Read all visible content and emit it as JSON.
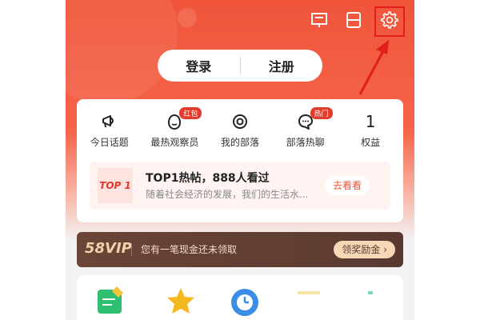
{
  "header": {
    "icons": [
      "scan-icon",
      "qr-code-icon",
      "settings-icon"
    ]
  },
  "auth": {
    "login": "登录",
    "register": "注册"
  },
  "menu": [
    {
      "label": "今日话题",
      "icon": "megaphone-icon",
      "badge": ""
    },
    {
      "label": "最热观察员",
      "icon": "face-icon",
      "badge": "红包"
    },
    {
      "label": "我的部落",
      "icon": "target-icon",
      "badge": ""
    },
    {
      "label": "部落热聊",
      "icon": "chat-icon",
      "badge": "热门"
    },
    {
      "label": "权益",
      "icon": "number",
      "value": "1",
      "badge": ""
    }
  ],
  "hot": {
    "logo": "TOP 1",
    "title": "TOP1热帖，888人看过",
    "desc": "随着社会经济的发展，我们的生活水...",
    "action": "去看看"
  },
  "vip": {
    "logo": "58VIP",
    "text": "您有一笔现金还未领取",
    "action": "领奖励金 ›"
  },
  "colors": {
    "brand": "#f0553a",
    "highlight": "#e11d1d",
    "vip_bg": "#5a3a30"
  }
}
